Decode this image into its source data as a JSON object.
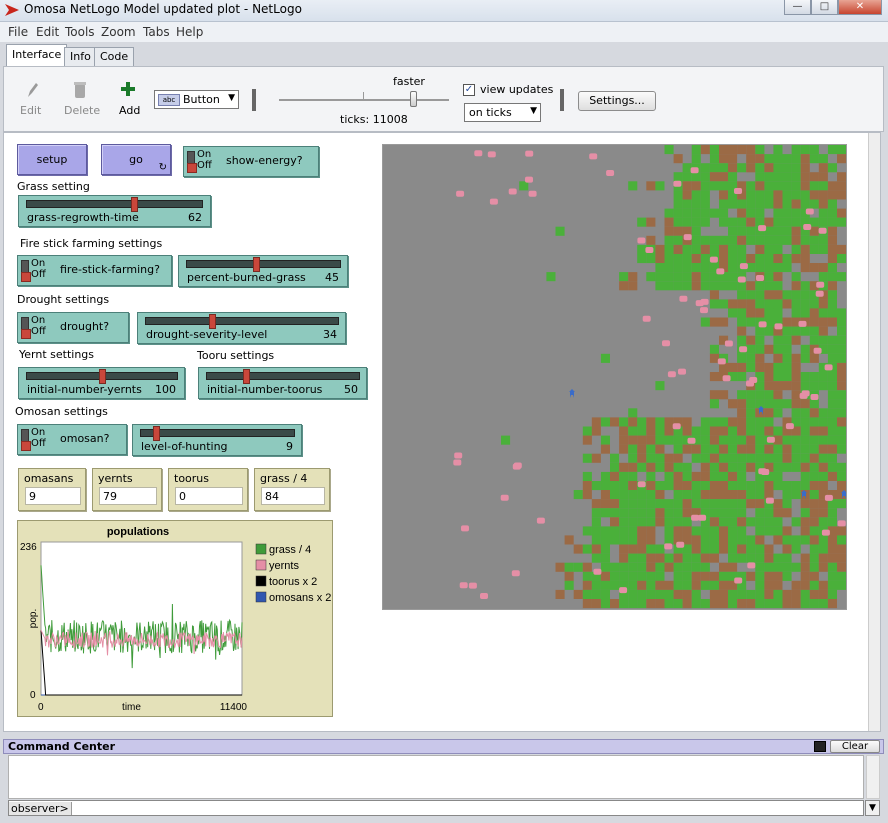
{
  "window": {
    "title": "Omosa NetLogo Model updated plot - NetLogo",
    "min_label": "—",
    "max_label": "□",
    "close_label": "✕"
  },
  "menu": [
    "File",
    "Edit",
    "Tools",
    "Zoom",
    "Tabs",
    "Help"
  ],
  "tabs": [
    {
      "label": "Interface",
      "active": true
    },
    {
      "label": "Info"
    },
    {
      "label": "Code"
    }
  ],
  "toolbar": {
    "edit_label": "Edit",
    "delete_label": "Delete",
    "add_label": "Add",
    "widget_type": "Button",
    "speed_label": "faster",
    "ticks_label": "ticks: 11008",
    "view_updates_label": "view updates",
    "view_updates_checked": true,
    "update_mode": "on ticks",
    "settings_label": "Settings..."
  },
  "buttons": {
    "setup": "setup",
    "go": "go"
  },
  "switches": {
    "show_energy": {
      "label": "show-energy?",
      "on": "On",
      "off": "Off"
    },
    "fire_stick": {
      "label": "fire-stick-farming?",
      "on": "On",
      "off": "Off"
    },
    "drought": {
      "label": "drought?",
      "on": "On",
      "off": "Off"
    },
    "omosan": {
      "label": "omosan?",
      "on": "On",
      "off": "Off"
    }
  },
  "sections": {
    "grass": "Grass setting",
    "fire": "Fire stick farming settings",
    "drought": "Drought settings",
    "yernt": "Yernt settings",
    "tooru": "Tooru settings",
    "omosan": "Omosan settings"
  },
  "sliders": {
    "grass_regrowth": {
      "name": "grass-regrowth-time",
      "value": "62",
      "fraction": 0.62
    },
    "percent_burned": {
      "name": "percent-burned-grass",
      "value": "45",
      "fraction": 0.45
    },
    "drought_severity": {
      "name": "drought-severity-level",
      "value": "34",
      "fraction": 0.34
    },
    "init_yernts": {
      "name": "initial-number-yernts",
      "value": "100",
      "fraction": 0.5
    },
    "init_toorus": {
      "name": "initial-number-toorus",
      "value": "50",
      "fraction": 0.25
    },
    "hunting": {
      "name": "level-of-hunting",
      "value": "9",
      "fraction": 0.09
    }
  },
  "monitors": [
    {
      "label": "omasans",
      "value": "9"
    },
    {
      "label": "yernts",
      "value": "79"
    },
    {
      "label": "toorus",
      "value": "0"
    },
    {
      "label": "grass / 4",
      "value": "84"
    }
  ],
  "chart_data": {
    "type": "line",
    "title": "populations",
    "xlabel": "time",
    "ylabel": "pop.",
    "xlim": [
      0,
      11400
    ],
    "ylim": [
      0,
      236
    ],
    "x_tick_labels": [
      "0",
      "11400"
    ],
    "y_tick_labels": [
      "0",
      "236"
    ],
    "legend_position": "right",
    "series": [
      {
        "name": "grass / 4",
        "color": "#3f9b3a",
        "level": 90,
        "noise": 26,
        "init": 200
      },
      {
        "name": "yernts",
        "color": "#e58fa6",
        "level": 85,
        "noise": 12,
        "init": 100
      },
      {
        "name": "toorus x 2",
        "color": "#000000",
        "level": 0,
        "noise": 0,
        "init": 100
      },
      {
        "name": "omosans x 2",
        "color": "#3056b0",
        "level": 0,
        "noise": 0,
        "init": 0
      }
    ]
  },
  "world_colors": {
    "gray": "#8a8a8a",
    "green": "#4ab03a",
    "brown": "#9b6a45",
    "pink": "#e58fa6",
    "blue": "#3a6cc9"
  },
  "command_center": {
    "title": "Command Center",
    "clear_label": "Clear",
    "prompt": "observer>"
  }
}
